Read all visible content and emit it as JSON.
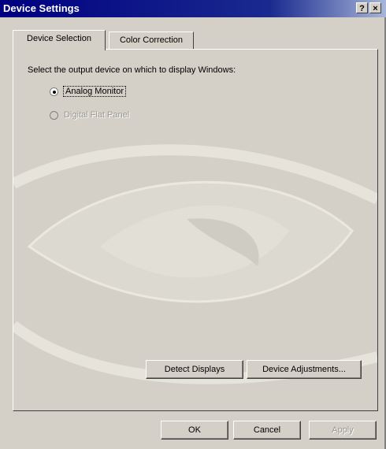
{
  "window": {
    "title": "Device Settings",
    "help_button": "?",
    "close_button": "×"
  },
  "tabs": [
    {
      "label": "Device Selection",
      "active": true
    },
    {
      "label": "Color Correction",
      "active": false
    }
  ],
  "panel": {
    "instruction": "Select the output device on which to display Windows:",
    "options": [
      {
        "label": "Analog Monitor",
        "selected": true,
        "enabled": true
      },
      {
        "label": "Digital Flat Panel",
        "selected": false,
        "enabled": false
      }
    ],
    "detect_displays_label": "Detect Displays",
    "device_adjustments_label": "Device Adjustments..."
  },
  "footer": {
    "ok_label": "OK",
    "cancel_label": "Cancel",
    "apply_label": "Apply"
  }
}
